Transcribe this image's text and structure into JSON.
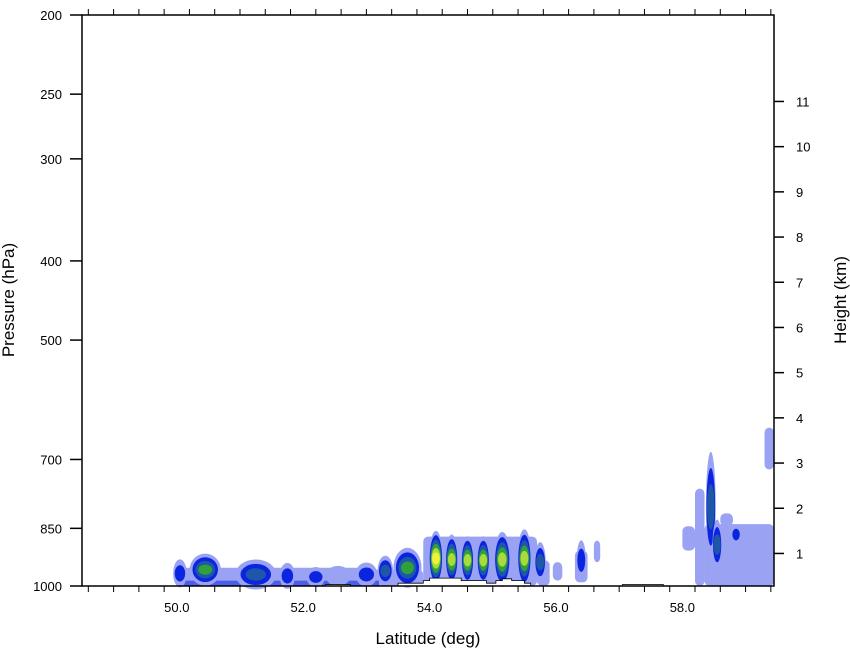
{
  "chart_data": {
    "type": "contour",
    "xlabel": "Latitude (deg)",
    "ylabel": "Pressure (hPa)",
    "y2label": "Height (km)",
    "xlim": [
      48.5,
      59.45
    ],
    "xticks": [
      50.0,
      52.0,
      54.0,
      56.0,
      58.0
    ],
    "xtick_labels": [
      "50.0",
      "52.0",
      "54.0",
      "56.0",
      "58.0"
    ],
    "ylim_pressure": [
      1000,
      200
    ],
    "y_scale": "log",
    "yticks": [
      200,
      250,
      300,
      400,
      500,
      700,
      850,
      1000
    ],
    "ytick_labels": [
      "200",
      "250",
      "300",
      "400",
      "500",
      "700",
      "850",
      "1000"
    ],
    "y2ticks": [
      1,
      2,
      3,
      4,
      5,
      6,
      7,
      8,
      9,
      10,
      11
    ],
    "y2tick_labels": [
      "1",
      "2",
      "3",
      "4",
      "5",
      "6",
      "7",
      "8",
      "9",
      "10",
      "11"
    ],
    "grid": false,
    "colors": {
      "level1": "#9aa2f4",
      "level2": "#0b24e0",
      "level3": "#1f57a8",
      "level4": "#2fa03c",
      "level5": "#a9dc3a",
      "level6": "#eff23a",
      "terrain": "#ffffff"
    },
    "cells": [
      {
        "lat": 50.45,
        "p": 955,
        "w": 0.4,
        "h": 32,
        "level": 4
      },
      {
        "lat": 50.05,
        "p": 965,
        "w": 0.12,
        "h": 28,
        "level": 2
      },
      {
        "lat": 51.25,
        "p": 968,
        "w": 0.55,
        "h": 30,
        "level": 3
      },
      {
        "lat": 51.75,
        "p": 972,
        "w": 0.15,
        "h": 26,
        "level": 2
      },
      {
        "lat": 52.2,
        "p": 975,
        "w": 0.2,
        "h": 20,
        "level": 2
      },
      {
        "lat": 52.55,
        "p": 972,
        "w": 0.3,
        "h": 20,
        "level": 1
      },
      {
        "lat": 53.0,
        "p": 968,
        "w": 0.25,
        "h": 24,
        "level": 2
      },
      {
        "lat": 53.3,
        "p": 958,
        "w": 0.15,
        "h": 30,
        "level": 3
      },
      {
        "lat": 53.65,
        "p": 950,
        "w": 0.35,
        "h": 40,
        "level": 4
      },
      {
        "lat": 54.1,
        "p": 925,
        "w": 0.12,
        "h": 55,
        "level": 6
      },
      {
        "lat": 54.35,
        "p": 928,
        "w": 0.1,
        "h": 50,
        "level": 5
      },
      {
        "lat": 54.6,
        "p": 930,
        "w": 0.1,
        "h": 48,
        "level": 5
      },
      {
        "lat": 54.85,
        "p": 930,
        "w": 0.1,
        "h": 48,
        "level": 5
      },
      {
        "lat": 55.15,
        "p": 928,
        "w": 0.16,
        "h": 55,
        "level": 5
      },
      {
        "lat": 55.5,
        "p": 925,
        "w": 0.12,
        "h": 58,
        "level": 5
      },
      {
        "lat": 55.75,
        "p": 935,
        "w": 0.08,
        "h": 40,
        "level": 3
      },
      {
        "lat": 56.4,
        "p": 930,
        "w": 0.05,
        "h": 40,
        "level": 2
      },
      {
        "lat": 58.45,
        "p": 800,
        "w": 0.06,
        "h": 110,
        "level": 3
      },
      {
        "lat": 58.55,
        "p": 890,
        "w": 0.05,
        "h": 50,
        "level": 3
      },
      {
        "lat": 58.85,
        "p": 865,
        "w": 0.04,
        "h": 20,
        "level": 2
      }
    ]
  }
}
